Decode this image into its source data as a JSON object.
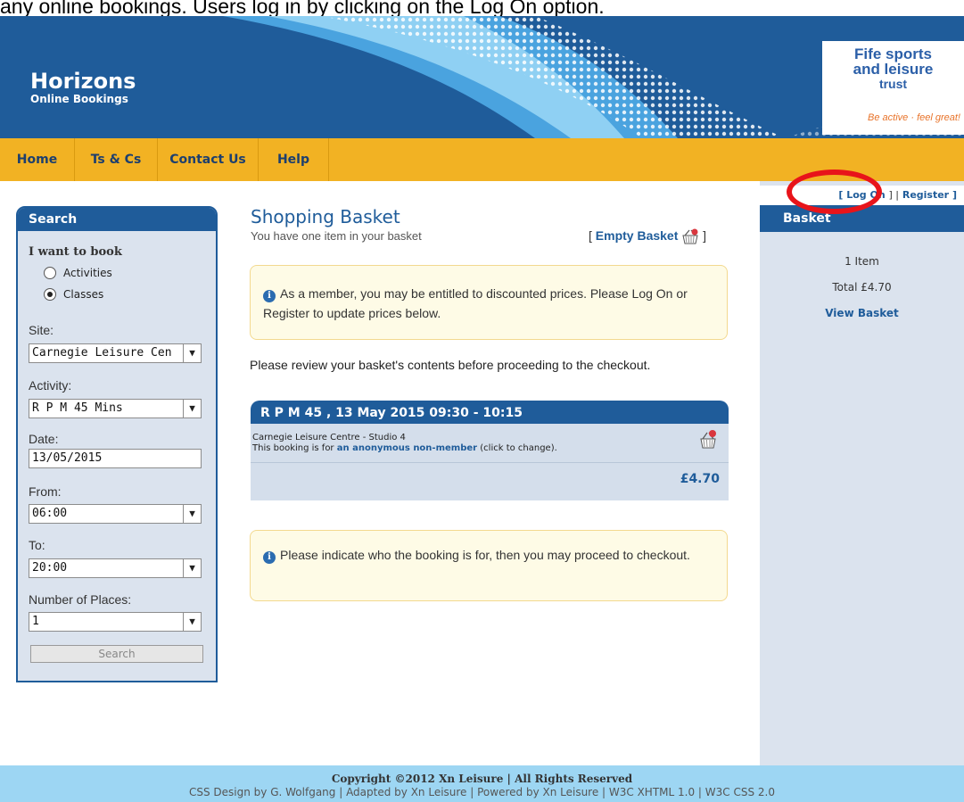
{
  "caption": "any online bookings. Users log in by clicking on the Log On option.",
  "brand": {
    "title": "Horizons",
    "subtitle": "Online Bookings"
  },
  "logo": {
    "line1": "Fife sports",
    "line2": "and leisure",
    "line3": "trust",
    "tagline": "Be active · feel great!"
  },
  "nav": [
    {
      "label": "Home"
    },
    {
      "label": "Ts & Cs"
    },
    {
      "label": "Contact Us"
    },
    {
      "label": "Help"
    }
  ],
  "auth": {
    "open": "[",
    "log_on": "Log On",
    "mid": "] |",
    "register": "Register",
    "close": "]"
  },
  "basket_panel": {
    "title": "Basket",
    "items": "1 Item",
    "total": "Total £4.70",
    "view": "View Basket"
  },
  "search": {
    "title": "Search",
    "want_label": "I want to book",
    "option_activities": "Activities",
    "option_classes": "Classes",
    "selected_option": "Classes",
    "site_label": "Site:",
    "site_value": "Carnegie Leisure Cen",
    "activity_label": "Activity:",
    "activity_value": "R P M 45 Mins",
    "date_label": "Date:",
    "date_value": "13/05/2015",
    "from_label": "From:",
    "from_value": "06:00",
    "to_label": "To:",
    "to_value": "20:00",
    "places_label": "Number of Places:",
    "places_value": "1",
    "button": "Search"
  },
  "main": {
    "title": "Shopping Basket",
    "subtitle": "You have one item in your basket",
    "empty_open": "[",
    "empty_label": "Empty Basket",
    "empty_close": "]",
    "notice1": "As a member, you may be entitled to discounted prices. Please Log On or Register to update prices below.",
    "review": "Please review your basket's contents before proceeding to the checkout.",
    "notice2": "Please indicate who the booking is for, then you may proceed to checkout."
  },
  "booking": {
    "title": "R P M 45 , 13 May 2015 09:30 - 10:15",
    "location": "Carnegie Leisure Centre -  Studio 4",
    "for_prefix": "This booking is for",
    "member": "an anonymous non-member",
    "for_suffix": "(click to change).",
    "price": "£4.70"
  },
  "footer": {
    "line1": "Copyright ©2012 Xn Leisure | All Rights Reserved",
    "line2": "CSS Design by G. Wolfgang | Adapted by Xn Leisure | Powered by Xn Leisure | W3C XHTML 1.0 | W3C CSS 2.0"
  },
  "colors": {
    "brand_blue": "#1f5c9a",
    "nav_orange": "#f2b223",
    "panel_bg": "#dbe3ee",
    "footer_bg": "#9dd6f3",
    "highlight_red": "#e8141a"
  },
  "icons": [
    "basket-icon",
    "info-icon",
    "remove-basket-icon",
    "chevron-down-icon",
    "radio-icon"
  ]
}
